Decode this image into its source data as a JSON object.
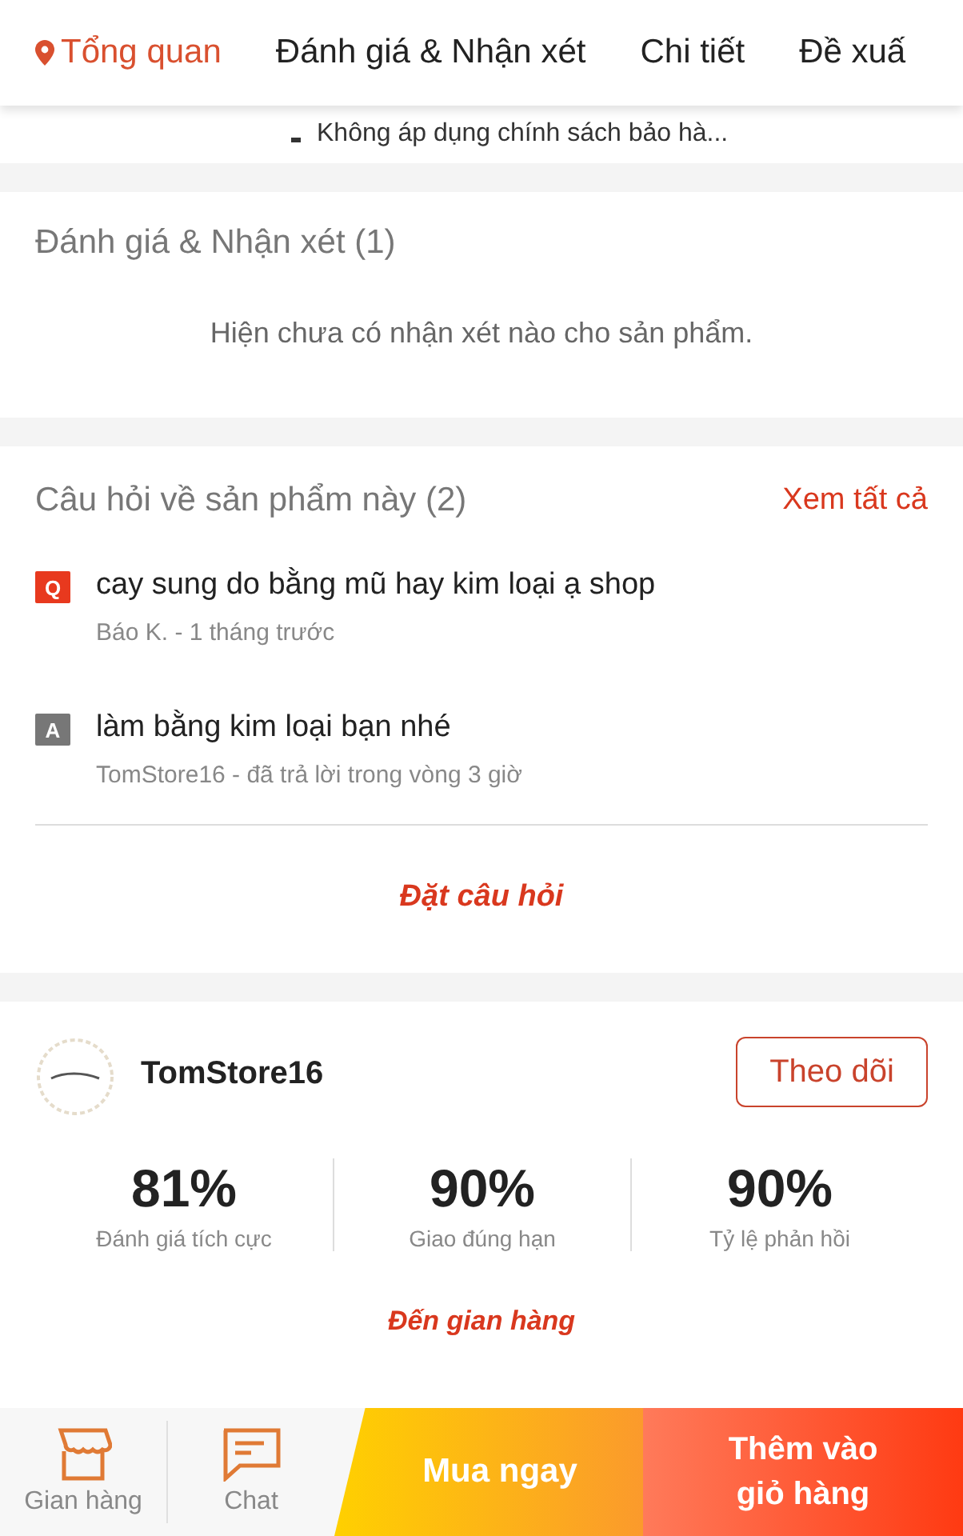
{
  "tabs": [
    {
      "label": "Tổng quan",
      "selected": true
    },
    {
      "label": "Đánh giá & Nhận xét",
      "selected": false
    },
    {
      "label": "Chi tiết",
      "selected": false
    },
    {
      "label": "Đề xuấ",
      "selected": false
    }
  ],
  "policy_note": "Không áp dụng chính sách bảo hà...",
  "reviews": {
    "title": "Đánh giá & Nhận xét (1)",
    "empty": "Hiện chưa có nhận xét nào cho sản phẩm."
  },
  "questions": {
    "title": "Câu hỏi về sản phẩm này (2)",
    "see_all": "Xem tất cả",
    "ask": "Đặt câu hỏi",
    "items": [
      {
        "kind": "question",
        "badge": "Q",
        "text": "cay sung do bằng mũ hay kim loại ạ shop",
        "meta": "Báo K. - 1 tháng trước"
      },
      {
        "kind": "answer",
        "badge": "A",
        "text": "làm bằng kim loại bạn nhé",
        "meta": "TomStore16 - đã trả lời trong vòng 3 giờ"
      }
    ]
  },
  "store": {
    "name": "TomStore16",
    "follow": "Theo dõi",
    "visit": "Đến gian hàng",
    "stats": [
      {
        "value": "81%",
        "label": "Đánh giá tích cực"
      },
      {
        "value": "90%",
        "label": "Giao đúng hạn"
      },
      {
        "value": "90%",
        "label": "Tỷ lệ phản hồi"
      }
    ]
  },
  "bottom_bar": {
    "store": "Gian hàng",
    "chat": "Chat",
    "buy_now": "Mua ngay",
    "add_to_cart": "Thêm vào\ngiỏ hàng"
  }
}
